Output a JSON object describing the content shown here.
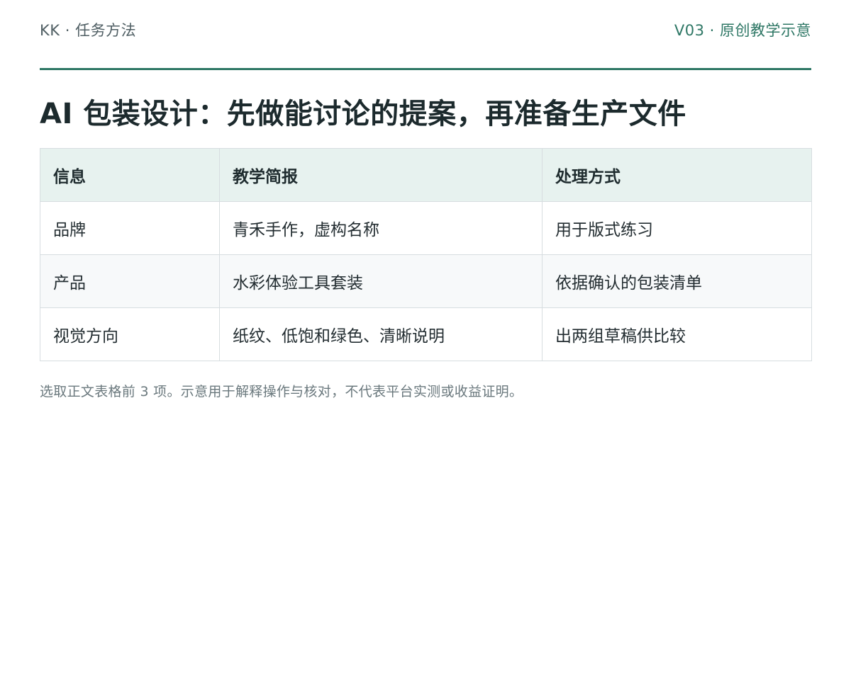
{
  "header": {
    "left": "KK · 任务方法",
    "right": "V03 · 原创教学示意"
  },
  "title": "AI 包装设计：先做能讨论的提案，再准备生产文件",
  "table": {
    "headers": [
      "信息",
      "教学简报",
      "处理方式"
    ],
    "rows": [
      [
        "品牌",
        "青禾手作，虚构名称",
        "用于版式练习"
      ],
      [
        "产品",
        "水彩体验工具套装",
        "依据确认的包装清单"
      ],
      [
        "视觉方向",
        "纸纹、低饱和绿色、清晰说明",
        "出两组草稿供比较"
      ]
    ]
  },
  "footnote": "选取正文表格前 3 项。示意用于解释操作与核对，不代表平台实测或收益证明。",
  "colors": {
    "accent": "#2e7765",
    "header_bg": "#e7f2ef"
  }
}
